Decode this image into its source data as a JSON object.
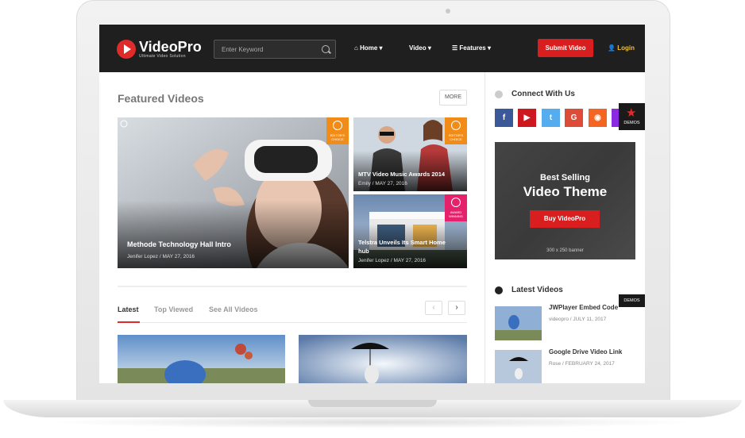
{
  "header": {
    "logo_name": "VideoPro",
    "logo_tagline": "Ultimate Video Solution",
    "search_placeholder": "Enter Keyword",
    "nav": [
      "Home",
      "Video",
      "Features"
    ],
    "submit_label": "Submit Video",
    "login_label": "Login"
  },
  "featured": {
    "heading": "Featured Videos",
    "more_label": "MORE",
    "cards": [
      {
        "title": "Methode Technology Hall Intro",
        "author": "Jenifer Lopez",
        "date": "MAY 27, 2016"
      },
      {
        "title": "MTV Video Music Awards 2014",
        "author": "Emily",
        "date": "MAY 27, 2016",
        "badge": "EDITOR'S CHOICE"
      },
      {
        "title": "Telstra Unveils Its Smart Home hub",
        "author": "Jenifer Lopez",
        "date": "MAY 27, 2016",
        "badge": "AWARD WINNING"
      }
    ],
    "main_badge": "EDITOR'S CHOICE"
  },
  "tabs": {
    "items": [
      "Latest",
      "Top Viewed",
      "See All Videos"
    ],
    "active": "Latest"
  },
  "sidebar": {
    "connect_heading": "Connect With Us",
    "social": [
      {
        "name": "facebook",
        "glyph": "f",
        "color": "#3b5998"
      },
      {
        "name": "youtube",
        "glyph": "▶",
        "color": "#cc181e"
      },
      {
        "name": "twitter",
        "glyph": "t",
        "color": "#55acee"
      },
      {
        "name": "google-plus",
        "glyph": "G",
        "color": "#dd4b39"
      },
      {
        "name": "rss",
        "glyph": "◉",
        "color": "#f26522"
      }
    ],
    "demos_label": "DEMOS",
    "banner": {
      "line1": "Best Selling",
      "line2": "Video Theme",
      "button": "Buy VideoPro",
      "size_note": "300 x 250 banner"
    },
    "latest_heading": "Latest Videos",
    "latest": [
      {
        "title": "JWPlayer Embed Code",
        "author": "videopro",
        "date": "JULY 11, 2017"
      },
      {
        "title": "Google Drive Video Link",
        "author": "Rose",
        "date": "FEBRUARY 24, 2017"
      }
    ]
  },
  "colors": {
    "accent": "#e02b2b",
    "header_bg": "#1f1f1f",
    "badge_orange": "#f28c18",
    "badge_pink": "#e6216b"
  }
}
